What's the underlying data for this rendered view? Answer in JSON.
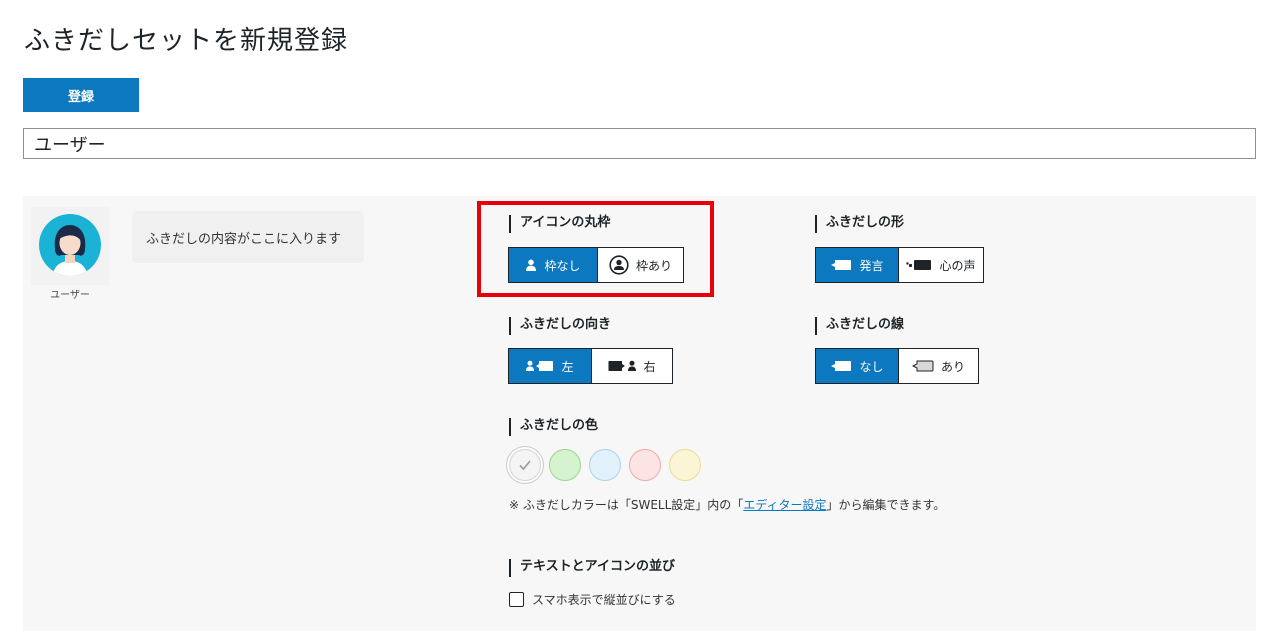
{
  "page": {
    "title": "ふきだしセットを新規登録",
    "register_label": "登録",
    "set_name_value": "ユーザー"
  },
  "preview": {
    "avatar_name": "ユーザー",
    "bubble_text": "ふきだしの内容がここに入ります"
  },
  "settings": {
    "icon_frame": {
      "label": "アイコンの丸枠",
      "options": [
        "枠なし",
        "枠あり"
      ],
      "selected": "枠なし"
    },
    "bubble_shape": {
      "label": "ふきだしの形",
      "options": [
        "発言",
        "心の声"
      ],
      "selected": "発言"
    },
    "bubble_direction": {
      "label": "ふきだしの向き",
      "options": [
        "左",
        "右"
      ],
      "selected": "左"
    },
    "bubble_border": {
      "label": "ふきだしの線",
      "options": [
        "なし",
        "あり"
      ],
      "selected": "なし"
    },
    "bubble_color": {
      "label": "ふきだしの色",
      "swatches": [
        {
          "name": "default",
          "fill": "#f4f4f4",
          "border": "#d4d4d4",
          "selected": true
        },
        {
          "name": "green",
          "fill": "#d6f3d0",
          "border": "#9ad58d",
          "selected": false
        },
        {
          "name": "blue",
          "fill": "#e2f1fb",
          "border": "#a7d3ee",
          "selected": false
        },
        {
          "name": "red",
          "fill": "#fde4e4",
          "border": "#f0a8a8",
          "selected": false
        },
        {
          "name": "yellow",
          "fill": "#fbf5d6",
          "border": "#eadd96",
          "selected": false
        }
      ],
      "note_prefix": "※ ふきだしカラーは「SWELL設定」内の「",
      "note_link": "エディター設定",
      "note_suffix": "」から編集できます。"
    },
    "layout": {
      "label": "テキストとアイコンの並び",
      "checkbox_label": "スマホ表示で縦並びにする",
      "checked": false
    }
  },
  "colors": {
    "accent": "#0b78bf",
    "highlight": "#e8000b",
    "panel_bg": "#f7f7f7"
  }
}
